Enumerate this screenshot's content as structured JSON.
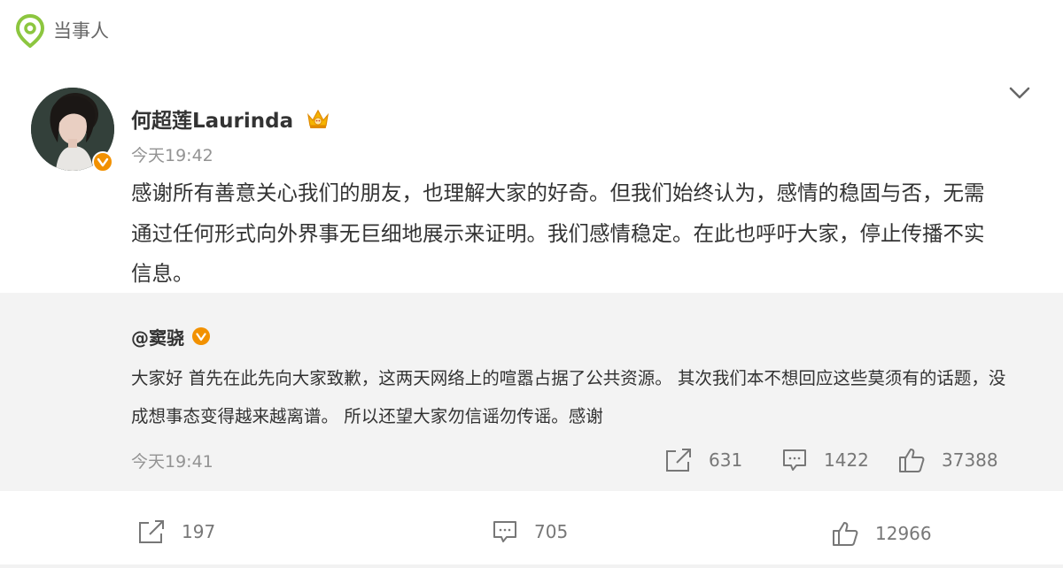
{
  "header": {
    "label": "当事人",
    "icon": "location-pin-icon",
    "accent": "#8cc63f"
  },
  "post": {
    "author": "何超莲Laurinda",
    "time": "今天19:42",
    "text": "感谢所有善意关心我们的朋友，也理解大家的好奇。但我们始终认为，感情的稳固与否，无需通过任何形式向外界事无巨细地展示来证明。我们感情稳定。在此也呼吁大家，停止传播不实信息。",
    "actions": {
      "share": "197",
      "comment": "705",
      "like": "12966"
    }
  },
  "quoted": {
    "author": "@窦骁",
    "text": "大家好 首先在此先向大家致歉，这两天网络上的喧嚣占据了公共资源。 其次我们本不想回应这些莫须有的话题，没成想事态变得越来越离谱。 所以还望大家勿信谣勿传谣。感谢",
    "time": "今天19:41",
    "actions": {
      "share": "631",
      "comment": "1422",
      "like": "37388"
    }
  },
  "colors": {
    "verified": "#f29100",
    "crown": "#f5b400",
    "quote_bg": "#f3f3f3"
  }
}
